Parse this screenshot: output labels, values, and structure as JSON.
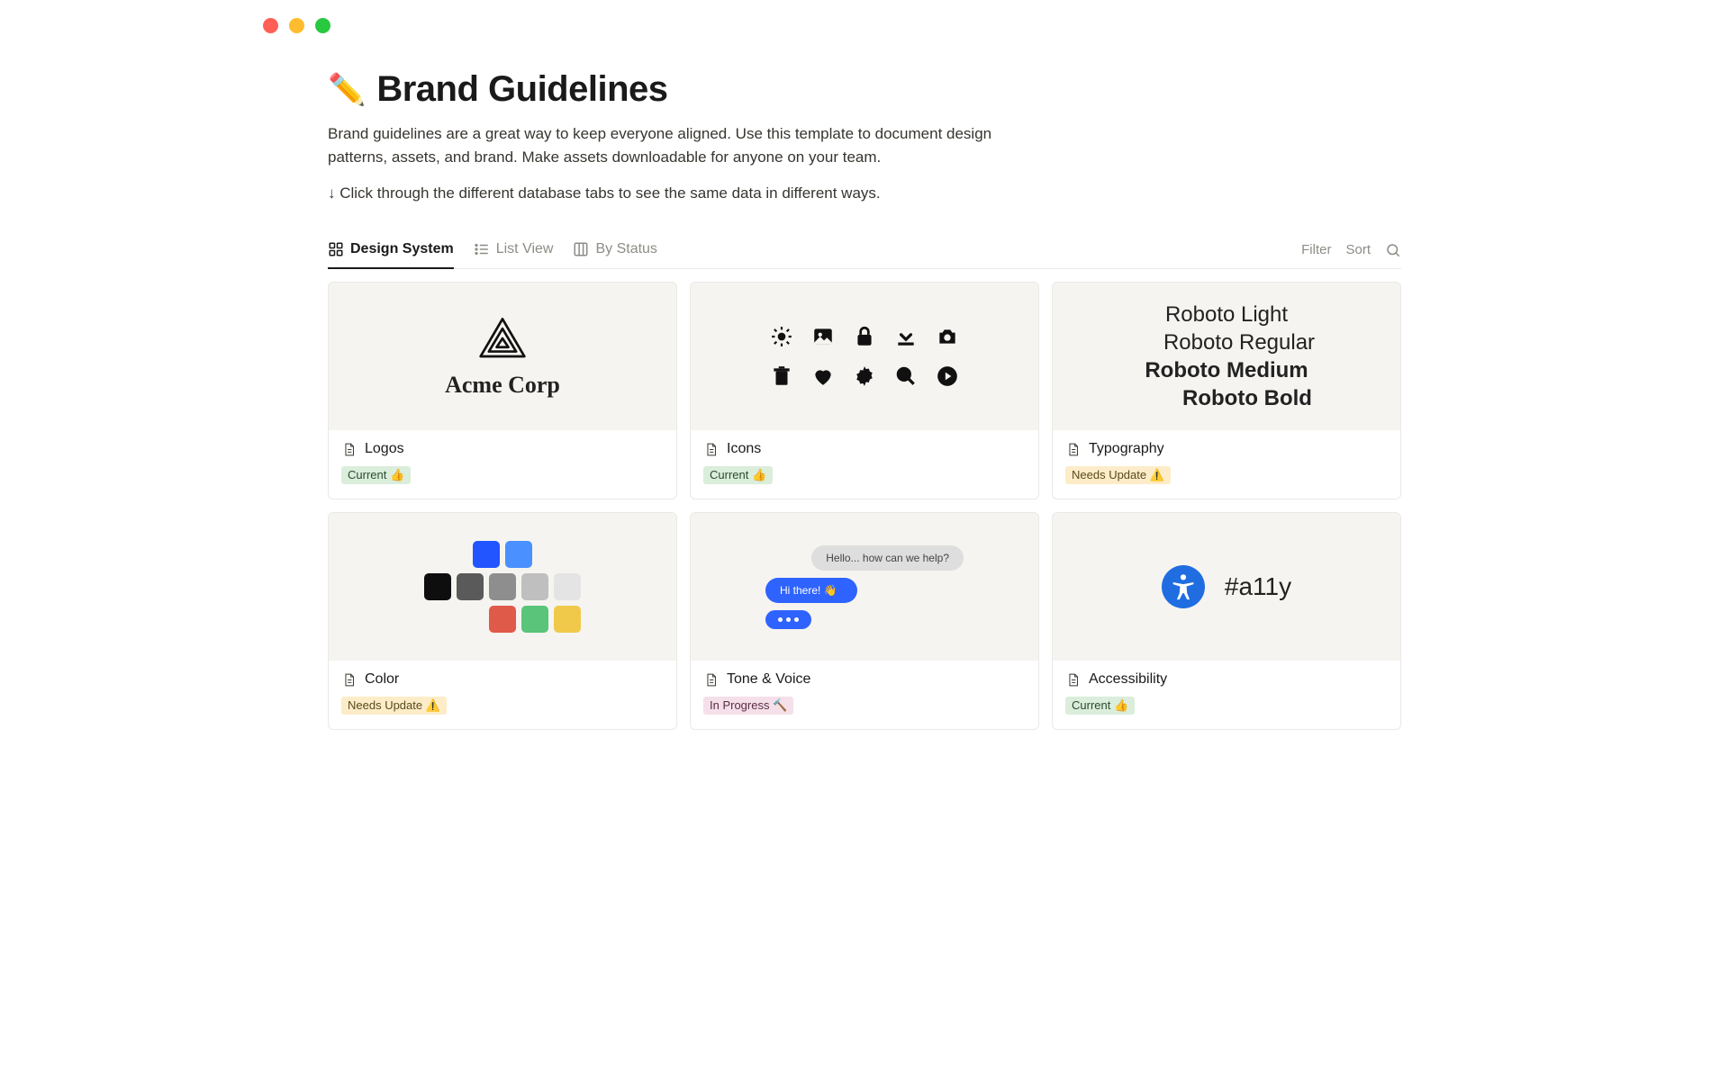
{
  "page": {
    "icon": "✏️",
    "title": "Brand Guidelines",
    "description": "Brand guidelines are a great way to keep everyone aligned. Use this template to document design patterns, assets, and brand. Make assets downloadable for anyone on your team.",
    "hint": "↓ Click through the different database tabs to see the same data in different ways."
  },
  "tabs": [
    {
      "label": "Design System",
      "active": true
    },
    {
      "label": "List View",
      "active": false
    },
    {
      "label": "By Status",
      "active": false
    }
  ],
  "controls": {
    "filter": "Filter",
    "sort": "Sort"
  },
  "statuses": {
    "current": "Current 👍",
    "needs_update": "Needs Update ⚠️",
    "in_progress": "In Progress 🔨"
  },
  "cards": [
    {
      "title": "Logos",
      "status": "current",
      "cover": "logos"
    },
    {
      "title": "Icons",
      "status": "current",
      "cover": "icons"
    },
    {
      "title": "Typography",
      "status": "needs_update",
      "cover": "typography"
    },
    {
      "title": "Color",
      "status": "needs_update",
      "cover": "color"
    },
    {
      "title": "Tone & Voice",
      "status": "in_progress",
      "cover": "tone"
    },
    {
      "title": "Accessibility",
      "status": "current",
      "cover": "a11y"
    }
  ],
  "covers": {
    "logos": {
      "brand": "Acme Corp"
    },
    "typography": {
      "light": "Roboto Light",
      "regular": "Roboto Regular",
      "medium": "Roboto Medium",
      "bold": "Roboto Bold"
    },
    "color": {
      "row1": [
        "#2255ff",
        "#4a90ff"
      ],
      "row2": [
        "#0e0e0e",
        "#5a5a5a",
        "#8e8e8e",
        "#bfbfbf",
        "#e4e4e4"
      ],
      "row3": [
        "#e05a4a",
        "#5ac47a",
        "#f1c94a"
      ]
    },
    "tone": {
      "msg1": "Hello... how can we help?",
      "msg2": "Hi there! 👋"
    },
    "a11y": {
      "label": "#a11y"
    }
  }
}
